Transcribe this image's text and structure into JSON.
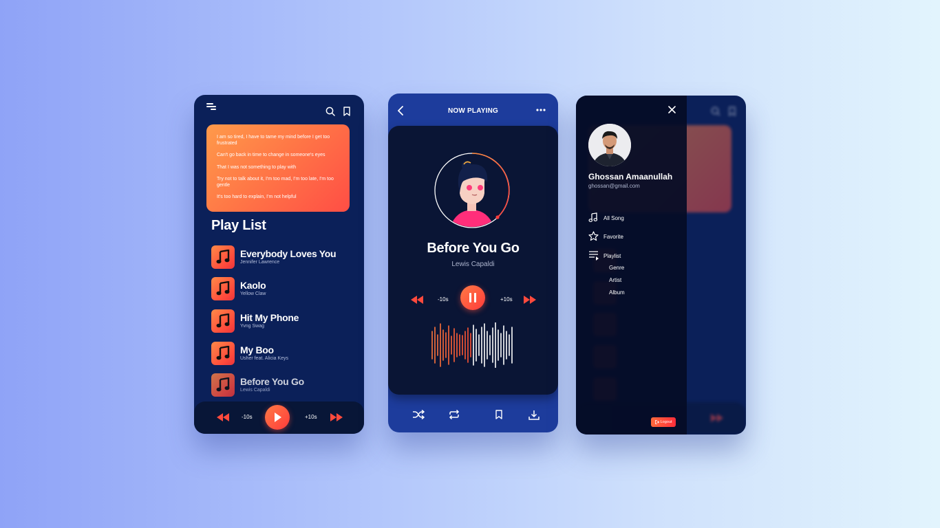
{
  "phone1": {
    "lyrics": [
      "I am so tired, I have to tame my mind before I get too frustrated",
      "Can't go back in time to change in someone's eyes",
      "That I was not something to play with",
      "Try not to talk about it, I'm too mad, I'm too late, I'm too gentle",
      "It's too hard to explain, I'm not helpful"
    ],
    "playlist_title": "Play List",
    "songs": [
      {
        "title": "Everybody Loves You",
        "artist": "Jennifer Lawrence"
      },
      {
        "title": "Kaolo",
        "artist": "Yellow Claw"
      },
      {
        "title": "Hit My Phone",
        "artist": "Yvng Swag"
      },
      {
        "title": "My Boo",
        "artist": "Usher feat. Alicia Keys"
      },
      {
        "title": "Before You Go",
        "artist": "Lewis Capaldi"
      }
    ],
    "controls": {
      "rewind_label": "-10s",
      "forward_label": "+10s"
    }
  },
  "phone2": {
    "header_title": "NOW PLAYING",
    "song_title": "Before You Go",
    "artist": "Lewis Capaldi",
    "controls": {
      "rewind_label": "-10s",
      "forward_label": "+10s"
    }
  },
  "phone3": {
    "user_name": "Ghossan Amaanullah",
    "user_email": "ghossan@gmail.com",
    "menu": [
      {
        "label": "All Song",
        "icon": "music-note-icon"
      },
      {
        "label": "Favorite",
        "icon": "star-icon"
      },
      {
        "label": "Playlist",
        "icon": "playlist-icon"
      }
    ],
    "submenu": [
      "Genre",
      "Artist",
      "Album"
    ],
    "logout_label": "Logout"
  },
  "colors": {
    "accent": "#ff5a3d",
    "panel_dark": "#0b2059",
    "panel_blue": "#1d3c9c"
  }
}
